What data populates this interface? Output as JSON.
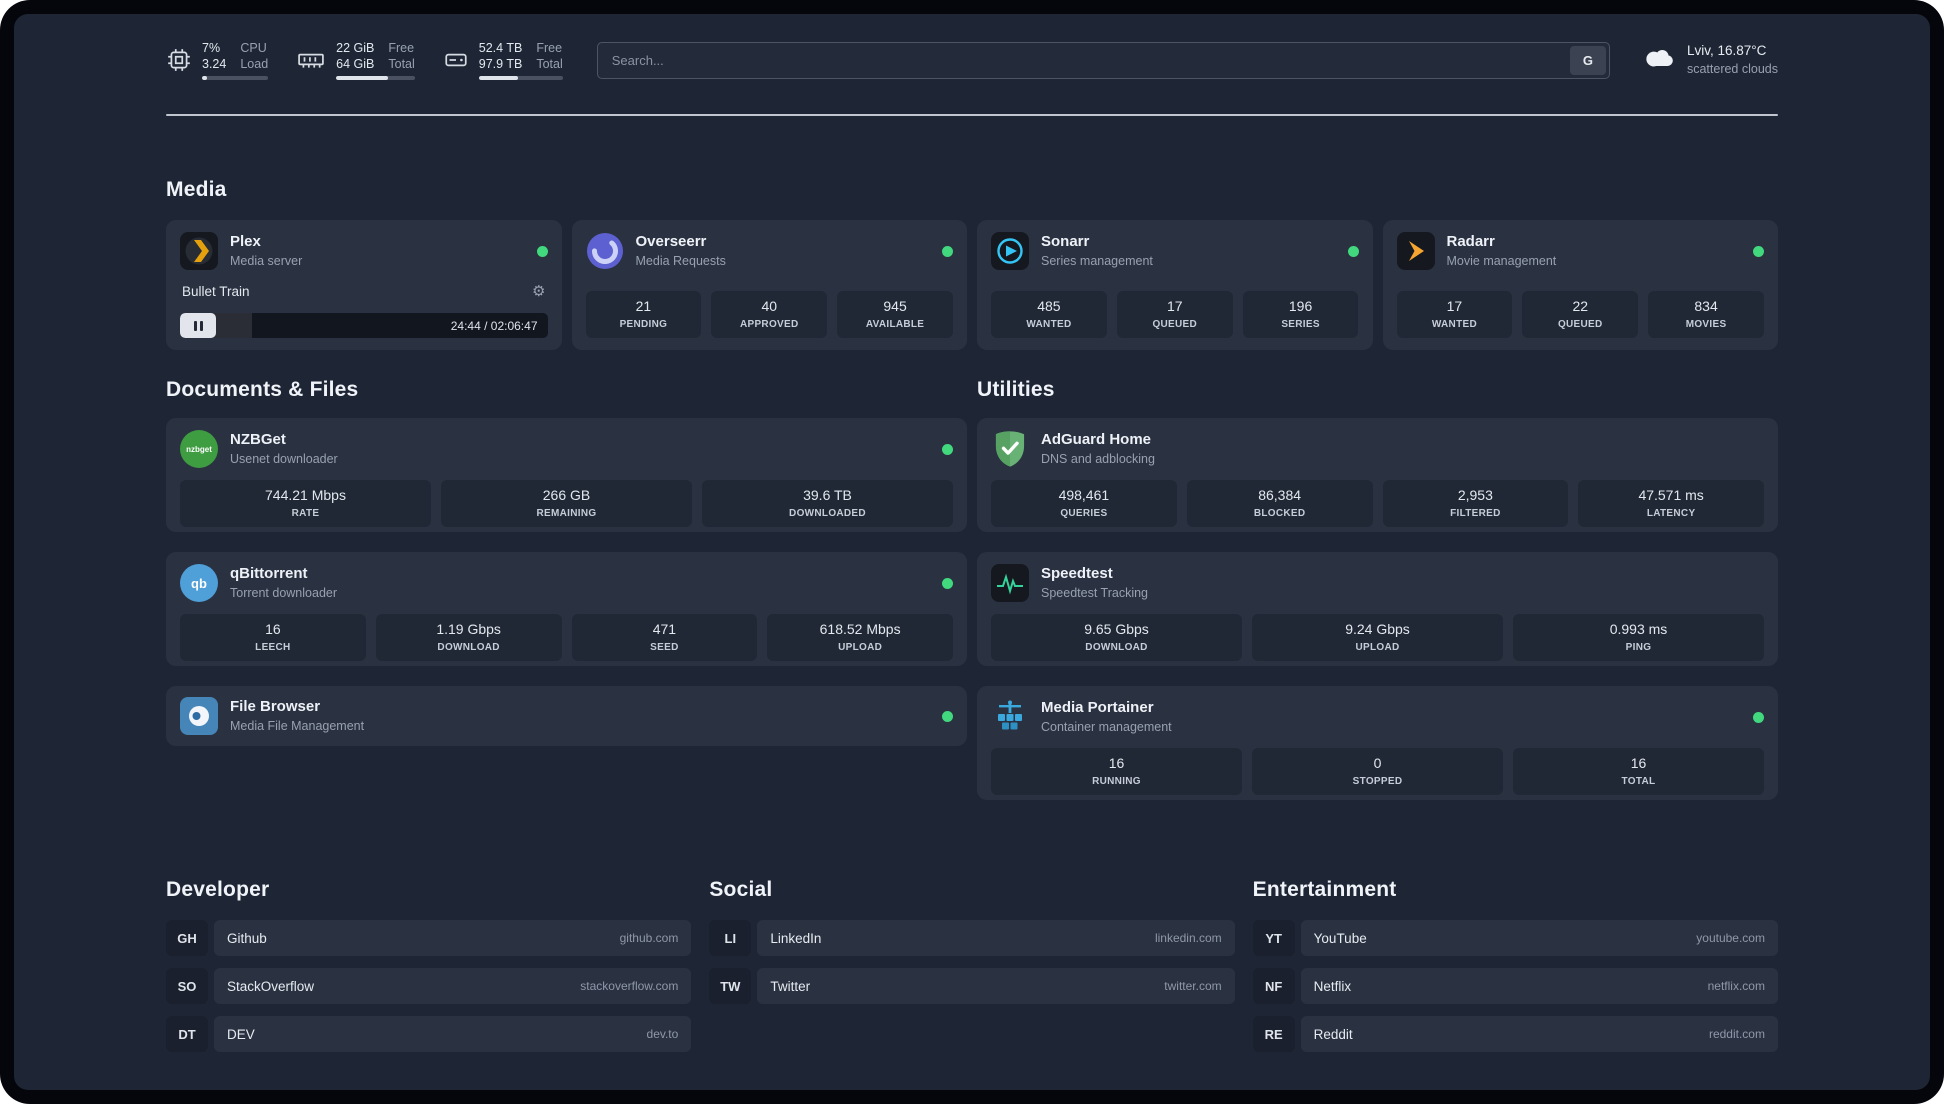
{
  "colors": {
    "status_green": "#41d87e",
    "plex_amber": "#e5a00d",
    "sonarr_blue": "#35c5f4",
    "radarr_amber": "#f7a531",
    "overseerr_purple": "#5d60d0",
    "nzbget_green": "#3e9c41",
    "qbittorrent_blue": "#4f9fd9",
    "filebrowser_blue": "#4585b7",
    "adguard_green": "#68b275",
    "speedtest_green": "#34d399",
    "portainer_blue": "#3ba8dd"
  },
  "topbar": {
    "cpu": {
      "value1": "7%",
      "value2": "3.24",
      "label1": "CPU",
      "label2": "Load",
      "percent": 7
    },
    "memory": {
      "value1": "22 GiB",
      "value2": "64 GiB",
      "label1": "Free",
      "label2": "Total",
      "percent": 66
    },
    "disk": {
      "value1": "52.4 TB",
      "value2": "97.9 TB",
      "label1": "Free",
      "label2": "Total",
      "percent": 47
    },
    "search": {
      "placeholder": "Search...",
      "button": "G"
    },
    "weather": {
      "location": "Lviv, 16.87°C",
      "condition": "scattered clouds"
    }
  },
  "media": {
    "title": "Media",
    "plex": {
      "name": "Plex",
      "subtitle": "Media server",
      "now_playing": "Bullet Train",
      "time": "24:44 / 02:06:47",
      "progress_percent": 19.5
    },
    "overseerr": {
      "name": "Overseerr",
      "subtitle": "Media Requests",
      "stats": [
        {
          "value": "21",
          "label": "PENDING"
        },
        {
          "value": "40",
          "label": "APPROVED"
        },
        {
          "value": "945",
          "label": "AVAILABLE"
        }
      ]
    },
    "sonarr": {
      "name": "Sonarr",
      "subtitle": "Series management",
      "stats": [
        {
          "value": "485",
          "label": "WANTED"
        },
        {
          "value": "17",
          "label": "QUEUED"
        },
        {
          "value": "196",
          "label": "SERIES"
        }
      ]
    },
    "radarr": {
      "name": "Radarr",
      "subtitle": "Movie management",
      "stats": [
        {
          "value": "17",
          "label": "WANTED"
        },
        {
          "value": "22",
          "label": "QUEUED"
        },
        {
          "value": "834",
          "label": "MOVIES"
        }
      ]
    }
  },
  "documents": {
    "title": "Documents & Files",
    "nzbget": {
      "name": "NZBGet",
      "subtitle": "Usenet downloader",
      "icon_text": "nzbget",
      "stats": [
        {
          "value": "744.21 Mbps",
          "label": "RATE"
        },
        {
          "value": "266 GB",
          "label": "REMAINING"
        },
        {
          "value": "39.6 TB",
          "label": "DOWNLOADED"
        }
      ]
    },
    "qbittorrent": {
      "name": "qBittorrent",
      "subtitle": "Torrent downloader",
      "icon_text": "qb",
      "stats": [
        {
          "value": "16",
          "label": "LEECH"
        },
        {
          "value": "1.19 Gbps",
          "label": "DOWNLOAD"
        },
        {
          "value": "471",
          "label": "SEED"
        },
        {
          "value": "618.52 Mbps",
          "label": "UPLOAD"
        }
      ]
    },
    "filebrowser": {
      "name": "File Browser",
      "subtitle": "Media File Management"
    }
  },
  "utilities": {
    "title": "Utilities",
    "adguard": {
      "name": "AdGuard Home",
      "subtitle": "DNS and adblocking",
      "stats": [
        {
          "value": "498,461",
          "label": "QUERIES"
        },
        {
          "value": "86,384",
          "label": "BLOCKED"
        },
        {
          "value": "2,953",
          "label": "FILTERED"
        },
        {
          "value": "47.571 ms",
          "label": "LATENCY"
        }
      ]
    },
    "speedtest": {
      "name": "Speedtest",
      "subtitle": "Speedtest Tracking",
      "stats": [
        {
          "value": "9.65 Gbps",
          "label": "DOWNLOAD"
        },
        {
          "value": "9.24 Gbps",
          "label": "UPLOAD"
        },
        {
          "value": "0.993 ms",
          "label": "PING"
        }
      ]
    },
    "portainer": {
      "name": "Media Portainer",
      "subtitle": "Container management",
      "stats": [
        {
          "value": "16",
          "label": "RUNNING"
        },
        {
          "value": "0",
          "label": "STOPPED"
        },
        {
          "value": "16",
          "label": "TOTAL"
        }
      ]
    }
  },
  "bookmarks": {
    "developer": {
      "title": "Developer",
      "items": [
        {
          "abbr": "GH",
          "name": "Github",
          "url": "github.com"
        },
        {
          "abbr": "SO",
          "name": "StackOverflow",
          "url": "stackoverflow.com"
        },
        {
          "abbr": "DT",
          "name": "DEV",
          "url": "dev.to"
        }
      ]
    },
    "social": {
      "title": "Social",
      "items": [
        {
          "abbr": "LI",
          "name": "LinkedIn",
          "url": "linkedin.com"
        },
        {
          "abbr": "TW",
          "name": "Twitter",
          "url": "twitter.com"
        }
      ]
    },
    "entertainment": {
      "title": "Entertainment",
      "items": [
        {
          "abbr": "YT",
          "name": "YouTube",
          "url": "youtube.com"
        },
        {
          "abbr": "NF",
          "name": "Netflix",
          "url": "netflix.com"
        },
        {
          "abbr": "RE",
          "name": "Reddit",
          "url": "reddit.com"
        }
      ]
    }
  }
}
